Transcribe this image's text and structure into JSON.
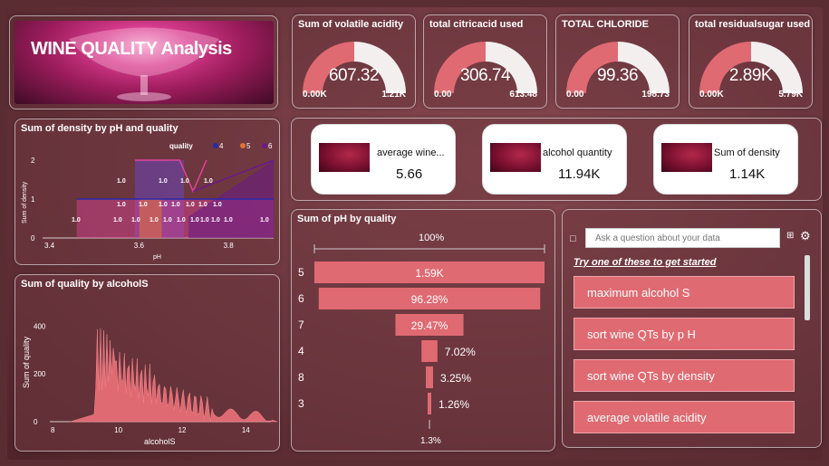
{
  "title": "WINE QUALITY Analysis",
  "gauges": [
    {
      "title": "Sum of volatile acidity",
      "value": "607.32",
      "min": "0.00K",
      "max": "1.21K",
      "fraction": 0.5
    },
    {
      "title": "total citricacid used",
      "value": "306.74",
      "min": "0.00",
      "max": "613.48",
      "fraction": 0.5
    },
    {
      "title": "TOTAL CHLORIDE",
      "value": "99.36",
      "min": "0.00",
      "max": "198.73",
      "fraction": 0.5
    },
    {
      "title": "total residualsugar used",
      "value": "2.89K",
      "min": "0.00K",
      "max": "5.79K",
      "fraction": 0.5
    }
  ],
  "cards": [
    {
      "label": "average wine...",
      "value": "5.66"
    },
    {
      "label": "alcohol quantity",
      "value": "11.94K"
    },
    {
      "label": "Sum of density",
      "value": "1.14K"
    }
  ],
  "density_chart": {
    "title": "Sum of density by pH and quality",
    "legend_title": "quality",
    "legend": [
      {
        "name": "4",
        "color": "#2a2aa8"
      },
      {
        "name": "5",
        "color": "#e0733a"
      },
      {
        "name": "6",
        "color": "#6a1a8a"
      },
      {
        "name": "7",
        "color": "#e0449a"
      },
      {
        "name": "8",
        "color": "#6b4ad8"
      }
    ],
    "xlabel": "pH",
    "ylabel": "Sum of density",
    "xticks": [
      "3.4",
      "3.6",
      "3.8"
    ],
    "yticks": [
      "0",
      "1",
      "2"
    ],
    "data_labels": [
      "1.0",
      "1.0",
      "1.0",
      "1.0",
      "1.0",
      "1.0",
      "1.0",
      "1.0",
      "1.0",
      "1.0",
      "1.0",
      "1.0",
      "1.0",
      "1.0",
      "1.0",
      "1.0",
      "1.0",
      "1.0",
      "1.0",
      "1.0",
      "1.0",
      "1.0"
    ]
  },
  "alcohol_chart": {
    "title": "Sum of quality by alcoholS",
    "xlabel": "alcoholS",
    "ylabel": "Sum of quality",
    "xticks": [
      "8",
      "10",
      "12",
      "14"
    ],
    "yticks": [
      "0",
      "200",
      "400"
    ],
    "xlim": [
      8,
      15
    ],
    "ylim": [
      0,
      500
    ]
  },
  "chart_data": [
    {
      "type": "bar",
      "title": "Sum of pH by quality",
      "categories": [
        "5",
        "6",
        "7",
        "4",
        "8",
        "3"
      ],
      "values": [
        1.59,
        1.53,
        0.47,
        0.11,
        0.05,
        0.02
      ],
      "labels": [
        "1.59K",
        "96.28%",
        "29.47%",
        "7.02%",
        "3.25%",
        "1.26%"
      ],
      "top_label": "100%",
      "bottom_label": "1.3%",
      "color": "#e06a72"
    },
    {
      "type": "area",
      "title": "Sum of quality by alcoholS",
      "xlabel": "alcoholS",
      "ylabel": "Sum of quality",
      "x": [
        8.5,
        9.0,
        9.2,
        9.4,
        9.5,
        9.6,
        9.8,
        10.0,
        10.2,
        10.5,
        10.8,
        11.0,
        11.3,
        11.5,
        12.0,
        12.5,
        13.0,
        13.5,
        14.0,
        14.5,
        15.0
      ],
      "y": [
        0,
        20,
        120,
        260,
        430,
        300,
        360,
        250,
        200,
        170,
        140,
        120,
        110,
        90,
        80,
        45,
        30,
        15,
        40,
        10,
        0
      ]
    }
  ],
  "qa": {
    "placeholder": "Ask a question about your data",
    "prompt": "Try one of these to get started",
    "suggestions": [
      "maximum alcohol S",
      "sort wine QTs by p H",
      "sort wine QTs by density",
      "average volatile acidity"
    ]
  }
}
